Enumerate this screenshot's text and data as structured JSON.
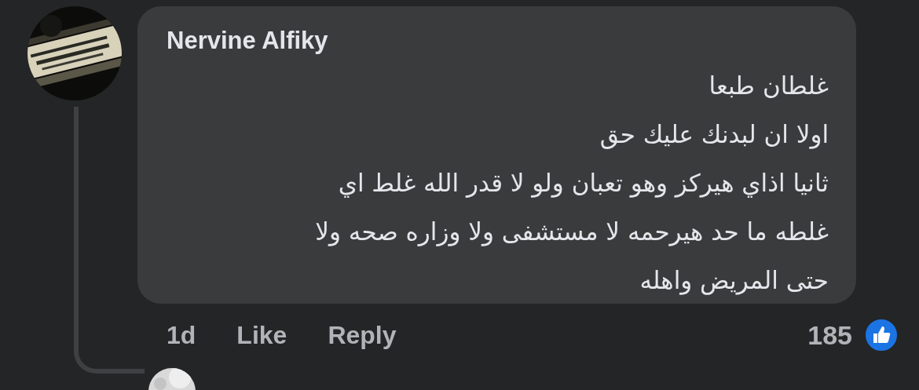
{
  "comment": {
    "author": "Nervine Alfiky",
    "body_lines": [
      "غلطان طبعا",
      "اولا ان لبدنك عليك حق",
      "ثانيا اذاي هيركز وهو تعبان ولو لا قدر الله غلط اي",
      "غلطه ما حد  هيرحمه لا مستشفى ولا وزاره صحه ولا",
      "حتى المريض واهله"
    ],
    "time": "1d",
    "like_action": "Like",
    "reply_action": "Reply",
    "reaction_count": "185"
  }
}
